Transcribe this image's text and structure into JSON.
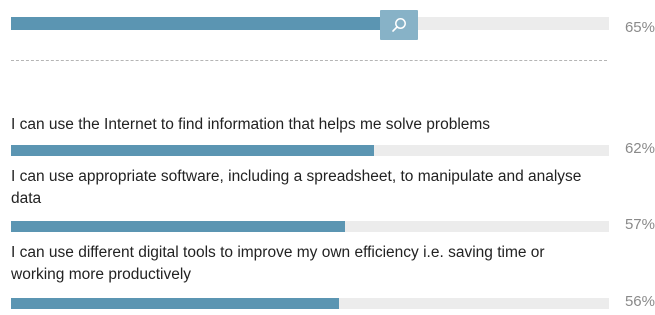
{
  "summary": {
    "value": 65,
    "value_label": "65%"
  },
  "search": {
    "icon": "search-icon"
  },
  "statements": [
    {
      "text": "I can use the Internet to find information that helps me solve problems",
      "value": 62,
      "value_label": "62%"
    },
    {
      "text": "I can use appropriate software, including a spreadsheet, to manipulate and analyse data",
      "value": 57,
      "value_label": "57%"
    },
    {
      "text": "I can use different digital tools to improve my own efficiency i.e. saving time or working more productively",
      "value": 56,
      "value_label": "56%"
    }
  ],
  "colors": {
    "bar_fill": "#5b95b2",
    "bar_track": "#ececec",
    "search_button": "#87b2c7",
    "percent_text": "#8a8a8a"
  }
}
